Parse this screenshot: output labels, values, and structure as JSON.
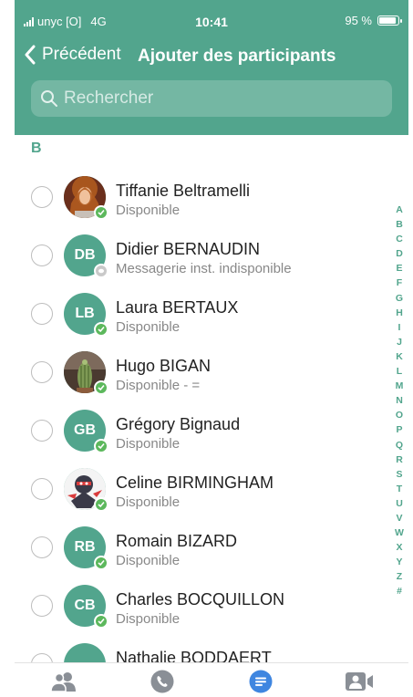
{
  "status_bar": {
    "carrier": "unyc [O]",
    "network": "4G",
    "time": "10:41",
    "battery": "95 %"
  },
  "nav": {
    "back_label": "Précédent",
    "title": "Ajouter des participants"
  },
  "search": {
    "placeholder": "Rechercher"
  },
  "section": {
    "letter": "B"
  },
  "contacts": [
    {
      "name": "Tiffanie Beltramelli",
      "status": "Disponible",
      "initials": "",
      "presence": "available"
    },
    {
      "name": "Didier BERNAUDIN",
      "status": "Messagerie inst. indisponible",
      "initials": "DB",
      "presence": "unavailable"
    },
    {
      "name": "Laura BERTAUX",
      "status": "Disponible",
      "initials": "LB",
      "presence": "available"
    },
    {
      "name": "Hugo BIGAN",
      "status": "Disponible - =",
      "initials": "",
      "presence": "available"
    },
    {
      "name": "Grégory Bignaud",
      "status": "Disponible",
      "initials": "GB",
      "presence": "available"
    },
    {
      "name": "Celine BIRMINGHAM",
      "status": "Disponible",
      "initials": "",
      "presence": "available"
    },
    {
      "name": "Romain BIZARD",
      "status": "Disponible",
      "initials": "RB",
      "presence": "available"
    },
    {
      "name": "Charles BOCQUILLON",
      "status": "Disponible",
      "initials": "CB",
      "presence": "available"
    },
    {
      "name": "Nathalie BODDAERT",
      "status": "",
      "initials": "",
      "presence": ""
    }
  ],
  "alphabet": [
    "A",
    "B",
    "C",
    "D",
    "E",
    "F",
    "G",
    "H",
    "I",
    "J",
    "K",
    "L",
    "M",
    "N",
    "O",
    "P",
    "Q",
    "R",
    "S",
    "T",
    "U",
    "V",
    "W",
    "X",
    "Y",
    "Z",
    "#"
  ],
  "tabs": [
    {
      "icon": "contacts-icon"
    },
    {
      "icon": "phone-icon"
    },
    {
      "icon": "messages-icon",
      "active": true
    },
    {
      "icon": "video-conference-icon"
    }
  ],
  "colors": {
    "accent": "#52a58d",
    "available": "#5cb85c",
    "tab_active": "#3f86e0",
    "tab_inactive": "#8a8f96"
  }
}
